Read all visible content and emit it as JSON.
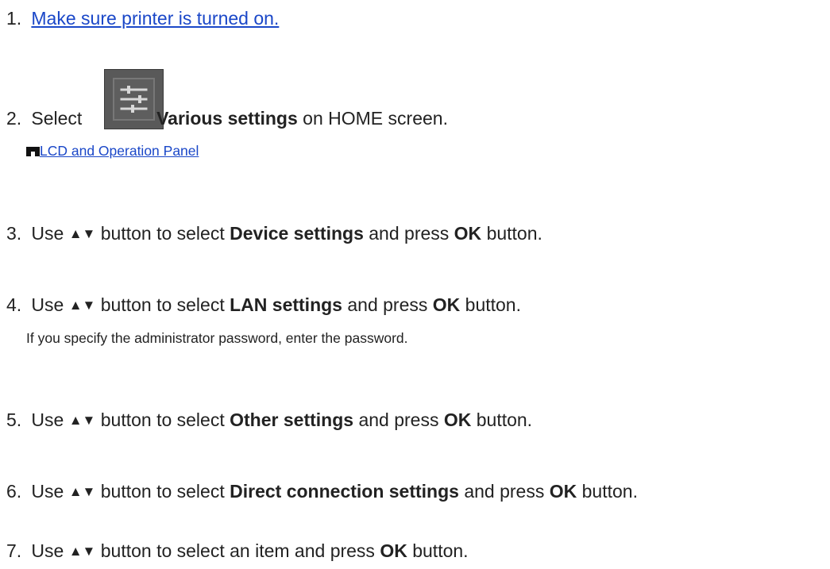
{
  "steps": [
    {
      "number": "1.",
      "link": "Make sure printer is turned on."
    },
    {
      "number": "2.",
      "pre": "Select",
      "bold": "Various settings",
      "post": "on HOME screen."
    },
    {
      "number": "3.",
      "pre": "Use",
      "mid": "button to select",
      "bold": "Device settings",
      "and_press": "and press",
      "ok": "OK",
      "post": "button."
    },
    {
      "number": "4.",
      "pre": "Use",
      "mid": "button to select",
      "bold": "LAN settings",
      "and_press": "and press",
      "ok": "OK",
      "post": "button."
    },
    {
      "number": "5.",
      "pre": "Use",
      "mid": "button to select",
      "bold": "Other settings",
      "and_press": "and press",
      "ok": "OK",
      "post": "button."
    },
    {
      "number": "6.",
      "pre": "Use",
      "mid": "button to select",
      "bold": "Direct connection settings",
      "and_press": "and press",
      "ok": "OK",
      "post": "button."
    },
    {
      "number": "7.",
      "pre": "Use",
      "mid": "button to select an item and press",
      "ok": "OK",
      "post": "button."
    }
  ],
  "arrows": "▲▼",
  "related_link": "LCD and Operation Panel",
  "note": "If you specify the administrator password, enter the password.",
  "icons": {
    "home_setting": "various-settings-icon",
    "link_marker": "link-marker-icon"
  },
  "colors": {
    "link": "#1a47c8",
    "text": "#222222",
    "icon_bg": "#595959"
  }
}
